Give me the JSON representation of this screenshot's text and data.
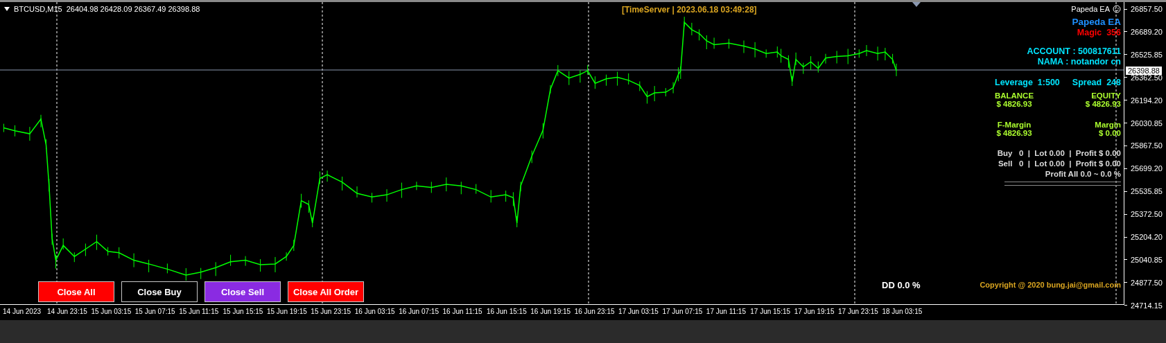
{
  "chart": {
    "symbol": "BTCUSD,M15",
    "ohlc": "26404.98 26428.09 26367.49 26398.88",
    "time_server": "[TimeServer | 2023.06.18 03:49:28]",
    "drawdown": "DD 0.0 %"
  },
  "ea_panel": {
    "indicator_label": "Papeda EA",
    "title": "Papeda EA",
    "magic": "Magic  356",
    "account": "ACCOUNT : 500817611",
    "name": "NAMA : notandor cn",
    "leverage": "Leverage  1:500",
    "spread": "Spread  248",
    "stats": [
      {
        "label": "BALANCE",
        "value": "$ 4826.93"
      },
      {
        "label": "EQUITY",
        "value": "$ 4826.93"
      },
      {
        "label": "F-Margin",
        "value": "$ 4826.93"
      },
      {
        "label": "Margin",
        "value": "$ 0.00"
      }
    ],
    "buy_line": "Buy   0  |  Lot 0.00  |  Profit $ 0.00",
    "sell_line": "Sell   0  |  Lot 0.00  |  Profit $ 0.00",
    "profit_all": "Profit All 0.0 ~ 0.0 %",
    "copyright": "Copyright @ 2020 bung.jai@gmail.com"
  },
  "buttons": [
    {
      "label": "Close All",
      "color": "#ff0000"
    },
    {
      "label": "Close Buy",
      "color": "#000000"
    },
    {
      "label": "Close Sell",
      "color": "#8a2be2"
    },
    {
      "label": "Close All Order",
      "color": "#ff0000"
    }
  ],
  "price_axis": {
    "labels": [
      "26857.50",
      "26689.20",
      "26525.85",
      "26362.50",
      "26194.20",
      "26030.85",
      "25867.50",
      "25699.20",
      "25535.85",
      "25372.50",
      "25204.20",
      "25040.85",
      "24877.50",
      "24714.15"
    ],
    "current_price": "26398.88"
  },
  "time_axis": {
    "labels": [
      "14 Jun 2023",
      "14 Jun 23:15",
      "15 Jun 03:15",
      "15 Jun 07:15",
      "15 Jun 11:15",
      "15 Jun 15:15",
      "15 Jun 19:15",
      "15 Jun 23:15",
      "16 Jun 03:15",
      "16 Jun 07:15",
      "16 Jun 11:15",
      "16 Jun 15:15",
      "16 Jun 19:15",
      "16 Jun 23:15",
      "17 Jun 03:15",
      "17 Jun 07:15",
      "17 Jun 11:15",
      "17 Jun 15:15",
      "17 Jun 19:15",
      "17 Jun 23:15",
      "18 Jun 03:15"
    ]
  }
}
